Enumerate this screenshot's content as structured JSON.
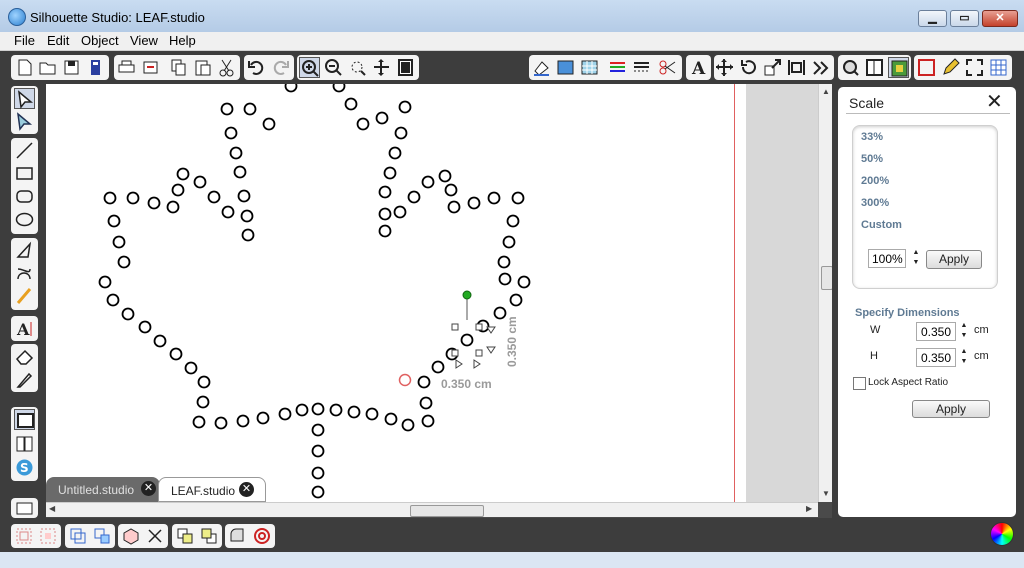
{
  "window": {
    "title": "Silhouette Studio: LEAF.studio"
  },
  "menu": {
    "items": [
      "File",
      "Edit",
      "Object",
      "View",
      "Help"
    ]
  },
  "tabs": [
    {
      "label": "Untitled.studio",
      "active": false
    },
    {
      "label": "LEAF.studio",
      "active": true
    }
  ],
  "canvas": {
    "width_label": "0.350 cm",
    "height_label": "0.350 cm",
    "dot_color": "#000000",
    "selected_color": "#e06060",
    "handle_color": "#22aa22"
  },
  "scale_panel": {
    "title": "Scale",
    "options": [
      "33%",
      "50%",
      "200%",
      "300%",
      "Custom"
    ],
    "custom_value": "100%",
    "apply_label": "Apply",
    "dimensions_title": "Specify Dimensions",
    "w_label": "W",
    "w_value": "0.350",
    "h_label": "H",
    "h_value": "0.350",
    "unit": "cm",
    "lock_label": "Lock Aspect Ratio",
    "lock_checked": false,
    "dims_apply_label": "Apply"
  },
  "toolbar_icons": [
    "new-document-icon",
    "open-icon",
    "save-icon",
    "save-to-sd-icon",
    "print-icon",
    "cut-print-icon",
    "copy-icon",
    "paste-icon",
    "cut-icon",
    "undo-icon",
    "redo-icon",
    "zoom-in-icon",
    "zoom-out-icon",
    "zoom-select-icon",
    "pan-icon",
    "fit-page-icon",
    "fill-icon",
    "page-setup-icon",
    "grid-icon",
    "line-color-icon",
    "line-style-icon",
    "cut-settings-icon",
    "text-style-icon",
    "transform-icon",
    "rotate-icon",
    "scale-icon",
    "align-icon",
    "replicate-icon",
    "library-icon",
    "store-icon",
    "trace-icon",
    "register-icon",
    "edit-pen-icon",
    "fullscreen-icon",
    "grid-view-icon"
  ]
}
